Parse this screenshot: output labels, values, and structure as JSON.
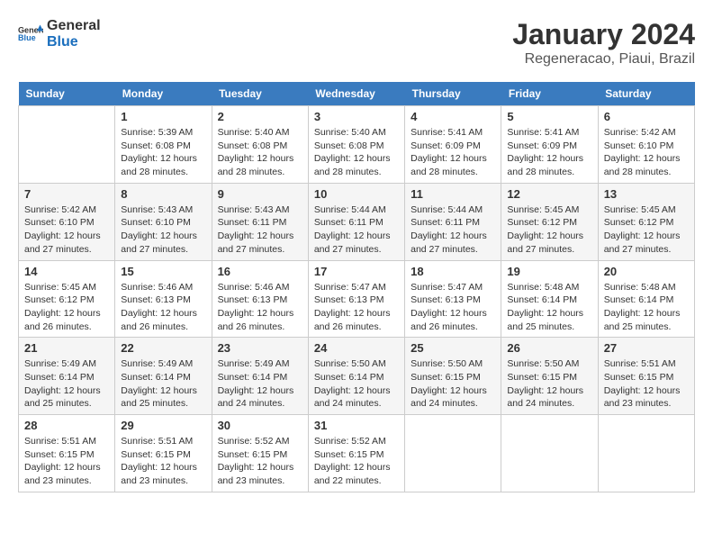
{
  "header": {
    "logo_general": "General",
    "logo_blue": "Blue",
    "month_year": "January 2024",
    "location": "Regeneracao, Piaui, Brazil"
  },
  "weekdays": [
    "Sunday",
    "Monday",
    "Tuesday",
    "Wednesday",
    "Thursday",
    "Friday",
    "Saturday"
  ],
  "weeks": [
    [
      {
        "day": "",
        "sunrise": "",
        "sunset": "",
        "daylight": ""
      },
      {
        "day": "1",
        "sunrise": "Sunrise: 5:39 AM",
        "sunset": "Sunset: 6:08 PM",
        "daylight": "Daylight: 12 hours and 28 minutes."
      },
      {
        "day": "2",
        "sunrise": "Sunrise: 5:40 AM",
        "sunset": "Sunset: 6:08 PM",
        "daylight": "Daylight: 12 hours and 28 minutes."
      },
      {
        "day": "3",
        "sunrise": "Sunrise: 5:40 AM",
        "sunset": "Sunset: 6:08 PM",
        "daylight": "Daylight: 12 hours and 28 minutes."
      },
      {
        "day": "4",
        "sunrise": "Sunrise: 5:41 AM",
        "sunset": "Sunset: 6:09 PM",
        "daylight": "Daylight: 12 hours and 28 minutes."
      },
      {
        "day": "5",
        "sunrise": "Sunrise: 5:41 AM",
        "sunset": "Sunset: 6:09 PM",
        "daylight": "Daylight: 12 hours and 28 minutes."
      },
      {
        "day": "6",
        "sunrise": "Sunrise: 5:42 AM",
        "sunset": "Sunset: 6:10 PM",
        "daylight": "Daylight: 12 hours and 28 minutes."
      }
    ],
    [
      {
        "day": "7",
        "sunrise": "Sunrise: 5:42 AM",
        "sunset": "Sunset: 6:10 PM",
        "daylight": "Daylight: 12 hours and 27 minutes."
      },
      {
        "day": "8",
        "sunrise": "Sunrise: 5:43 AM",
        "sunset": "Sunset: 6:10 PM",
        "daylight": "Daylight: 12 hours and 27 minutes."
      },
      {
        "day": "9",
        "sunrise": "Sunrise: 5:43 AM",
        "sunset": "Sunset: 6:11 PM",
        "daylight": "Daylight: 12 hours and 27 minutes."
      },
      {
        "day": "10",
        "sunrise": "Sunrise: 5:44 AM",
        "sunset": "Sunset: 6:11 PM",
        "daylight": "Daylight: 12 hours and 27 minutes."
      },
      {
        "day": "11",
        "sunrise": "Sunrise: 5:44 AM",
        "sunset": "Sunset: 6:11 PM",
        "daylight": "Daylight: 12 hours and 27 minutes."
      },
      {
        "day": "12",
        "sunrise": "Sunrise: 5:45 AM",
        "sunset": "Sunset: 6:12 PM",
        "daylight": "Daylight: 12 hours and 27 minutes."
      },
      {
        "day": "13",
        "sunrise": "Sunrise: 5:45 AM",
        "sunset": "Sunset: 6:12 PM",
        "daylight": "Daylight: 12 hours and 27 minutes."
      }
    ],
    [
      {
        "day": "14",
        "sunrise": "Sunrise: 5:45 AM",
        "sunset": "Sunset: 6:12 PM",
        "daylight": "Daylight: 12 hours and 26 minutes."
      },
      {
        "day": "15",
        "sunrise": "Sunrise: 5:46 AM",
        "sunset": "Sunset: 6:13 PM",
        "daylight": "Daylight: 12 hours and 26 minutes."
      },
      {
        "day": "16",
        "sunrise": "Sunrise: 5:46 AM",
        "sunset": "Sunset: 6:13 PM",
        "daylight": "Daylight: 12 hours and 26 minutes."
      },
      {
        "day": "17",
        "sunrise": "Sunrise: 5:47 AM",
        "sunset": "Sunset: 6:13 PM",
        "daylight": "Daylight: 12 hours and 26 minutes."
      },
      {
        "day": "18",
        "sunrise": "Sunrise: 5:47 AM",
        "sunset": "Sunset: 6:13 PM",
        "daylight": "Daylight: 12 hours and 26 minutes."
      },
      {
        "day": "19",
        "sunrise": "Sunrise: 5:48 AM",
        "sunset": "Sunset: 6:14 PM",
        "daylight": "Daylight: 12 hours and 25 minutes."
      },
      {
        "day": "20",
        "sunrise": "Sunrise: 5:48 AM",
        "sunset": "Sunset: 6:14 PM",
        "daylight": "Daylight: 12 hours and 25 minutes."
      }
    ],
    [
      {
        "day": "21",
        "sunrise": "Sunrise: 5:49 AM",
        "sunset": "Sunset: 6:14 PM",
        "daylight": "Daylight: 12 hours and 25 minutes."
      },
      {
        "day": "22",
        "sunrise": "Sunrise: 5:49 AM",
        "sunset": "Sunset: 6:14 PM",
        "daylight": "Daylight: 12 hours and 25 minutes."
      },
      {
        "day": "23",
        "sunrise": "Sunrise: 5:49 AM",
        "sunset": "Sunset: 6:14 PM",
        "daylight": "Daylight: 12 hours and 24 minutes."
      },
      {
        "day": "24",
        "sunrise": "Sunrise: 5:50 AM",
        "sunset": "Sunset: 6:14 PM",
        "daylight": "Daylight: 12 hours and 24 minutes."
      },
      {
        "day": "25",
        "sunrise": "Sunrise: 5:50 AM",
        "sunset": "Sunset: 6:15 PM",
        "daylight": "Daylight: 12 hours and 24 minutes."
      },
      {
        "day": "26",
        "sunrise": "Sunrise: 5:50 AM",
        "sunset": "Sunset: 6:15 PM",
        "daylight": "Daylight: 12 hours and 24 minutes."
      },
      {
        "day": "27",
        "sunrise": "Sunrise: 5:51 AM",
        "sunset": "Sunset: 6:15 PM",
        "daylight": "Daylight: 12 hours and 23 minutes."
      }
    ],
    [
      {
        "day": "28",
        "sunrise": "Sunrise: 5:51 AM",
        "sunset": "Sunset: 6:15 PM",
        "daylight": "Daylight: 12 hours and 23 minutes."
      },
      {
        "day": "29",
        "sunrise": "Sunrise: 5:51 AM",
        "sunset": "Sunset: 6:15 PM",
        "daylight": "Daylight: 12 hours and 23 minutes."
      },
      {
        "day": "30",
        "sunrise": "Sunrise: 5:52 AM",
        "sunset": "Sunset: 6:15 PM",
        "daylight": "Daylight: 12 hours and 23 minutes."
      },
      {
        "day": "31",
        "sunrise": "Sunrise: 5:52 AM",
        "sunset": "Sunset: 6:15 PM",
        "daylight": "Daylight: 12 hours and 22 minutes."
      },
      {
        "day": "",
        "sunrise": "",
        "sunset": "",
        "daylight": ""
      },
      {
        "day": "",
        "sunrise": "",
        "sunset": "",
        "daylight": ""
      },
      {
        "day": "",
        "sunrise": "",
        "sunset": "",
        "daylight": ""
      }
    ]
  ]
}
